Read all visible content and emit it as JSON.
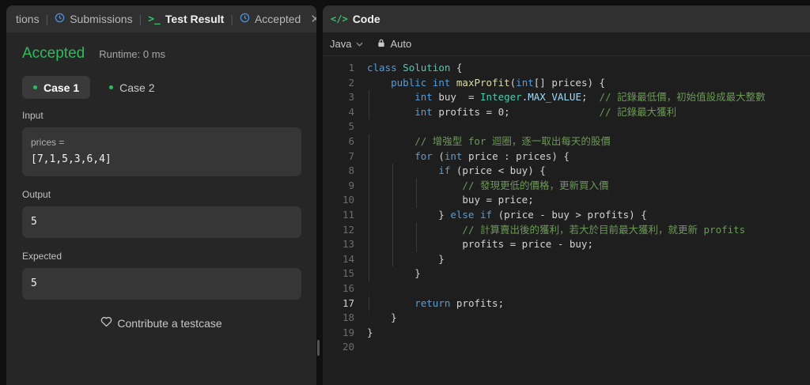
{
  "left_panel": {
    "tabs": [
      {
        "label": "tions"
      },
      {
        "label": "Submissions"
      },
      {
        "label": "Test Result"
      },
      {
        "label": "Accepted"
      }
    ],
    "status": "Accepted",
    "runtime": "Runtime: 0 ms",
    "cases": [
      "Case 1",
      "Case 2"
    ],
    "input_label": "Input",
    "input_var": "prices =",
    "input_value": "[7,1,5,3,6,4]",
    "output_label": "Output",
    "output_value": "5",
    "expected_label": "Expected",
    "expected_value": "5",
    "contribute": "Contribute a testcase"
  },
  "right_panel": {
    "title": "Code",
    "language": "Java",
    "mode": "Auto",
    "current_line": 17,
    "lines": [
      "class Solution {",
      "    public int maxProfit(int[] prices) {",
      "        int buy  = Integer.MAX_VALUE;  // 記錄最低價，初始值設成最大整數",
      "        int profits = 0;               // 記錄最大獲利",
      "",
      "        // 增強型 for 迴圈，逐一取出每天的股價",
      "        for (int price : prices) {",
      "            if (price < buy) {",
      "                // 發現更低的價格，更新買入價",
      "                buy = price;",
      "            } else if (price - buy > profits) {",
      "                // 計算賣出後的獲利，若大於目前最大獲利，就更新 profits",
      "                profits = price - buy;",
      "            }",
      "        }",
      "",
      "        return profits;",
      "    }",
      "}",
      ""
    ]
  },
  "colors": {
    "accepted_green": "#2cbb5d",
    "panel_bg": "#262626",
    "editor_bg": "#1e1e1e"
  }
}
